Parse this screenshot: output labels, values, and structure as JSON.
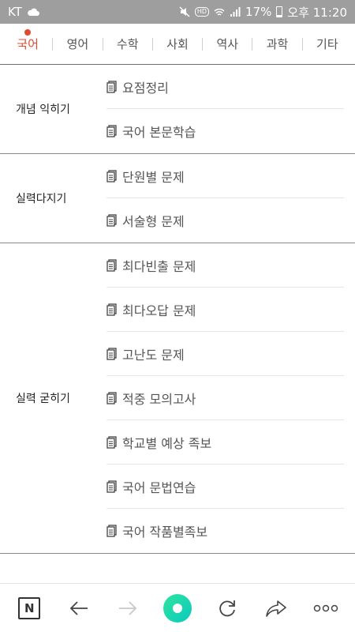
{
  "status_bar": {
    "carrier": "KT",
    "battery": "17%",
    "time": "오후 11:20",
    "icons": [
      "cloud-icon",
      "mute-icon",
      "hd-icon",
      "wifi-icon",
      "signal-icon",
      "battery-icon"
    ],
    "hd_label": "HD"
  },
  "tabs": [
    {
      "label": "국어",
      "active": true
    },
    {
      "label": "영어"
    },
    {
      "label": "수학"
    },
    {
      "label": "사회"
    },
    {
      "label": "역사"
    },
    {
      "label": "과학"
    },
    {
      "label": "기타"
    }
  ],
  "colors": {
    "accent": "#e04b2e",
    "status_bar": "#9e9e9e",
    "play_button": "#1dd6a6"
  },
  "sections": [
    {
      "title": "개념 익히기",
      "items": [
        "요점정리",
        "국어 본문학습"
      ]
    },
    {
      "title": "실력다지기",
      "items": [
        "단원별 문제",
        "서술형 문제"
      ]
    },
    {
      "title": "실력 굳히기",
      "items": [
        "최다빈출 문제",
        "최다오답 문제",
        "고난도 문제",
        "적중 모의고사",
        "학교별 예상 족보",
        "국어 문법연습",
        "국어 작품별족보"
      ]
    }
  ],
  "bottom_bar": {
    "home_label": "N",
    "buttons": [
      "naver-home-icon",
      "back-arrow-icon",
      "forward-arrow-icon",
      "green-dot-icon",
      "refresh-icon",
      "share-icon",
      "more-icon"
    ]
  }
}
